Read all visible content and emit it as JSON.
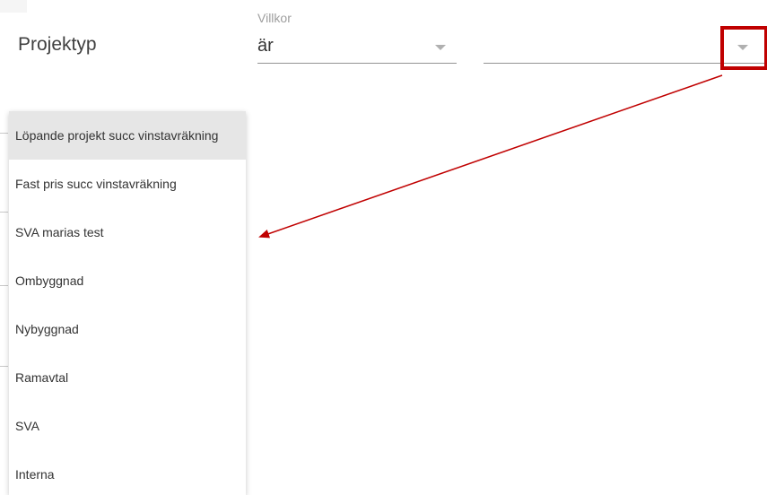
{
  "filter": {
    "field_label": "Projektyp",
    "condition_label": "Villkor",
    "condition_value": "är",
    "value_placeholder": ""
  },
  "dropdown": {
    "items": [
      {
        "label": "Löpande projekt succ vinstavräkning",
        "active": true
      },
      {
        "label": "Fast pris succ vinstavräkning",
        "active": false
      },
      {
        "label": "SVA marias test",
        "active": false
      },
      {
        "label": "Ombyggnad",
        "active": false
      },
      {
        "label": "Nybyggnad",
        "active": false
      },
      {
        "label": "Ramavtal",
        "active": false
      },
      {
        "label": "SVA",
        "active": false
      },
      {
        "label": "Interna",
        "active": false
      }
    ]
  },
  "annotation": {
    "highlight_color": "#c00000",
    "arrow_color": "#c00000"
  },
  "colors": {
    "active_item_bg": "#e6e6e6",
    "text": "#333333",
    "muted_label": "#9e9e9e",
    "underline": "#949494"
  }
}
